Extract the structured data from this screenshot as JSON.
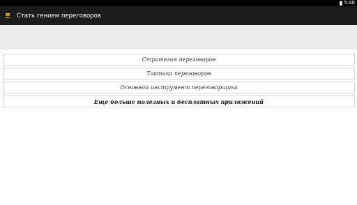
{
  "status_bar": {
    "time": "5:40",
    "battery_icon": "battery-icon"
  },
  "action_bar": {
    "menu_icon": "hamburger-menu-icon",
    "menu_icon_color": "#f3c200",
    "title": "Стать гением переговоров"
  },
  "menu": {
    "items": [
      {
        "label": "Стратегия переговоров"
      },
      {
        "label": "Тактика переговоров"
      },
      {
        "label": "Основной инструмент переговорщика"
      },
      {
        "label": "Еще больше полезных и бесплатных приложений"
      }
    ]
  }
}
